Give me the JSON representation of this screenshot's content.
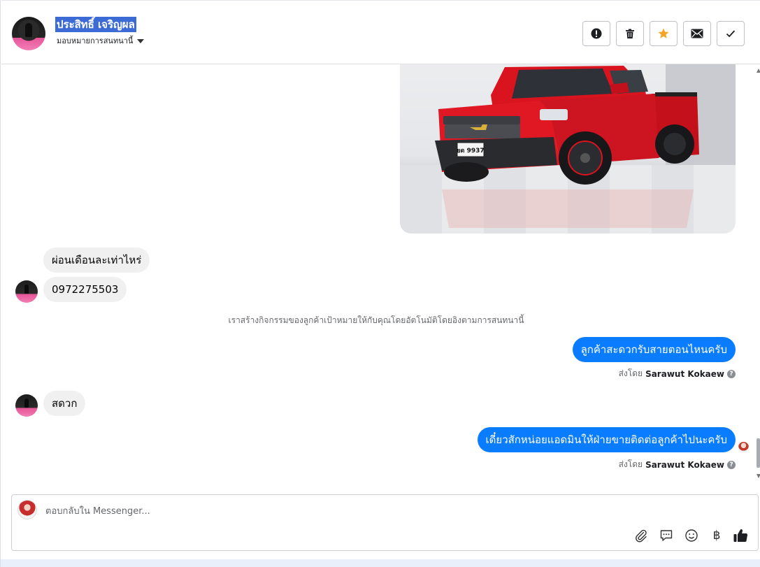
{
  "header": {
    "contact_name": "ประสิทธิ์ เจริญผล",
    "assign_label": "มอบหมายการสนทนานี้",
    "buttons": {
      "spam": "exclamation-icon",
      "delete": "trash-icon",
      "star": "star-icon",
      "mail": "envelope-icon",
      "done": "check-icon"
    },
    "star_color": "#f5a623"
  },
  "conversation": {
    "messages": [
      {
        "direction": "incoming",
        "text": "ผ่อนเดือนละเท่าไหร่"
      },
      {
        "direction": "incoming",
        "text": "0972275503"
      },
      {
        "direction": "outgoing",
        "text": "ลูกค้าสะดวกรับสายตอนไหนครับ"
      },
      {
        "direction": "incoming",
        "text": "สดวก"
      },
      {
        "direction": "outgoing",
        "text": "เดี๋ยวสักหน่อยแอดมินให้ฝ่ายขายติดต่อลูกค้าไปนะครับ"
      }
    ],
    "system_note": "เราสร้างกิจกรรมของลูกค้าเป้าหมายให้กับคุณโดยอัตโนมัติโดยอิงตามการสนทนานี้",
    "sent_by_prefix": "ส่งโดย",
    "sender_name": "Sarawut Kokaew",
    "car_plate": "ยด 9937",
    "outgoing_color": "#0a7cff",
    "incoming_color": "#f0f0f0"
  },
  "composer": {
    "placeholder": "ตอบกลับใน Messenger...",
    "baht_symbol": "฿",
    "tools": [
      "paperclip-icon",
      "saved-reply-icon",
      "emoji-icon",
      "baht-icon",
      "thumbs-up-icon"
    ]
  }
}
